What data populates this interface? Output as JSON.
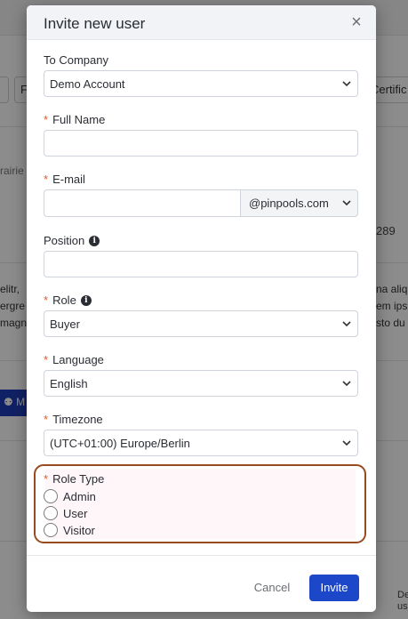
{
  "background": {
    "chips": [
      "",
      "F",
      "Certific"
    ],
    "side_left_top": "rairie",
    "side_right_number": "289",
    "paragraph_left": [
      "elitr,",
      "ergre",
      "magn"
    ],
    "paragraph_right": [
      "na aliq",
      "em ips",
      "sto du"
    ],
    "button_text": "M",
    "bottom_right": [
      "De",
      "us"
    ]
  },
  "modal": {
    "title": "Invite new user",
    "close_icon": "close-icon",
    "company": {
      "label": "To Company",
      "value": "Demo Account"
    },
    "full_name": {
      "label": "Full Name",
      "value": ""
    },
    "email": {
      "label": "E-mail",
      "value": "",
      "domain": "@pinpools.com"
    },
    "position": {
      "label": "Position",
      "value": ""
    },
    "role": {
      "label": "Role",
      "value": "Buyer"
    },
    "language": {
      "label": "Language",
      "value": "English"
    },
    "timezone": {
      "label": "Timezone",
      "value": "(UTC+01:00) Europe/Berlin"
    },
    "role_type": {
      "label": "Role Type",
      "options": [
        "Admin",
        "User",
        "Visitor"
      ]
    },
    "required_marker": "*",
    "info_glyph": "i",
    "cancel_label": "Cancel",
    "invite_label": "Invite"
  },
  "colors": {
    "accent": "#1d47c9",
    "required": "#e05a2c",
    "highlight_border": "#9a4a1f"
  }
}
